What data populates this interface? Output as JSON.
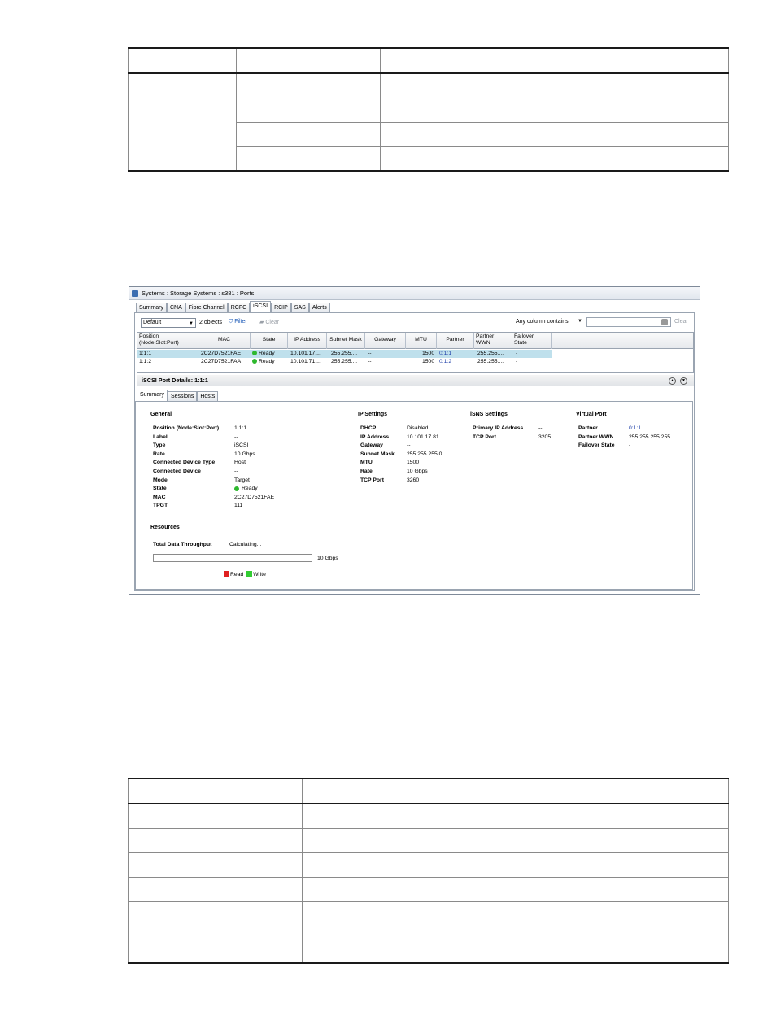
{
  "window": {
    "title": "Systems : Storage Systems : s381 : Ports",
    "tabs": [
      "Summary",
      "CNA",
      "Fibre Channel",
      "RCFC",
      "iSCSI",
      "RCIP",
      "SAS",
      "Alerts"
    ]
  },
  "toolbar": {
    "view_select": "Default",
    "object_count": "2 objects",
    "filter_label": "Filter",
    "clear_label": "Clear",
    "any_column_label": "Any column contains:",
    "search_value": "",
    "clear2_label": "Clear"
  },
  "grid": {
    "headers": [
      "Position\n(Node:Slot:Port)",
      "MAC",
      "State",
      "IP Address",
      "Subnet Mask",
      "Gateway",
      "MTU",
      "Partner",
      "Partner\nWWN",
      "Failover\nState"
    ],
    "rows": [
      {
        "position": "1:1:1",
        "mac": "2C27D7521FAE",
        "state": "Ready",
        "ip": "10.101.17....",
        "subnet": "255.255....",
        "gateway": "--",
        "mtu": "1500",
        "partner": "0:1:1",
        "partner_wwn": "255.255....",
        "failover": "-"
      },
      {
        "position": "1:1:2",
        "mac": "2C27D7521FAA",
        "state": "Ready",
        "ip": "10.101.71....",
        "subnet": "255.255....",
        "gateway": "--",
        "mtu": "1500",
        "partner": "0:1:2",
        "partner_wwn": "255.255....",
        "failover": "-"
      }
    ]
  },
  "details": {
    "title": "iSCSI Port Details: 1:1:1",
    "tabs": [
      "Summary",
      "Sessions",
      "Hosts"
    ],
    "general": {
      "heading": "General",
      "items": [
        {
          "k": "Position (Node:Slot:Port)",
          "v": "1:1:1"
        },
        {
          "k": "Label",
          "v": "--"
        },
        {
          "k": "Type",
          "v": "iSCSI"
        },
        {
          "k": "Rate",
          "v": "10 Gbps"
        },
        {
          "k": "Connected Device Type",
          "v": "Host"
        },
        {
          "k": "Connected Device",
          "v": "--"
        },
        {
          "k": "Mode",
          "v": "Target"
        },
        {
          "k": "State",
          "v": "Ready"
        },
        {
          "k": "MAC",
          "v": "2C27D7521FAE"
        },
        {
          "k": "TPGT",
          "v": "111"
        }
      ]
    },
    "ip_settings": {
      "heading": "IP Settings",
      "items": [
        {
          "k": "DHCP",
          "v": "Disabled"
        },
        {
          "k": "IP Address",
          "v": "10.101.17.81"
        },
        {
          "k": "Gateway",
          "v": "--"
        },
        {
          "k": "Subnet Mask",
          "v": "255.255.255.0"
        },
        {
          "k": "MTU",
          "v": "1500"
        },
        {
          "k": "Rate",
          "v": "10 Gbps"
        },
        {
          "k": "TCP Port",
          "v": "3260"
        }
      ]
    },
    "isns": {
      "heading": "iSNS Settings",
      "items": [
        {
          "k": "Primary IP Address",
          "v": "--"
        },
        {
          "k": "TCP Port",
          "v": "3205"
        }
      ]
    },
    "virtual_port": {
      "heading": "Virtual Port",
      "items": [
        {
          "k": "Partner",
          "v": "0:1:1"
        },
        {
          "k": "Partner WWN",
          "v": "255.255.255.255"
        },
        {
          "k": "Failover State",
          "v": "-"
        }
      ]
    },
    "resources": {
      "heading": "Resources",
      "throughput_label": "Total Data Throughput",
      "throughput_value": "Calculating...",
      "bar_max": "10 Gbps",
      "legend_read": "Read",
      "legend_write": "Write"
    }
  },
  "colors": {
    "ready": "#2eb82e",
    "read": "#e02020",
    "write": "#33cc33",
    "selected_row": "#bfe0ec",
    "link": "#1e3fa8"
  }
}
